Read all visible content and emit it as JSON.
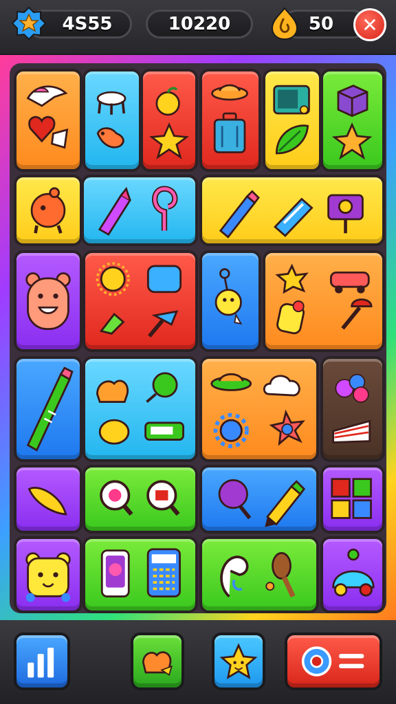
{
  "hud": {
    "left_value": "4S55",
    "center_value": "10220",
    "right_value": "50",
    "close_glyph": "✕"
  },
  "icons": {
    "left_stat": "star-badge-icon",
    "right_stat": "flame-drop-icon",
    "bottom": [
      "bar-chart-icon",
      "cake-icon",
      "star-face-icon",
      "settings-menu-icon"
    ]
  },
  "colors": {
    "orange": "#ff8a1e",
    "cyan": "#22b6ef",
    "red": "#e0281e",
    "yellow": "#ffcc1a",
    "green": "#3ac81e",
    "purple": "#8a2ef0",
    "blue": "#1e78ef",
    "brown": "#4a3226",
    "close_button": "#d8261a"
  }
}
